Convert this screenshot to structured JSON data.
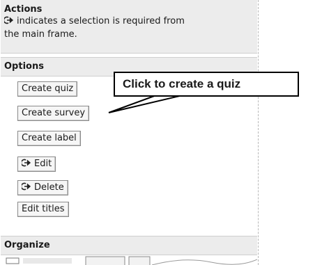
{
  "actions": {
    "title": "Actions",
    "desc_line1": "indicates a selection is required from",
    "desc_line2": "the main frame."
  },
  "options": {
    "header": "Options",
    "buttons": {
      "create_quiz": "Create quiz",
      "create_survey": "Create survey",
      "create_label": "Create label",
      "edit": "Edit",
      "delete": "Delete",
      "edit_titles": "Edit titles"
    }
  },
  "organize": {
    "header": "Organize"
  },
  "callout": {
    "text": "Click to create a quiz"
  },
  "icons": {
    "selection_required": "selection-required-arrow-icon"
  }
}
